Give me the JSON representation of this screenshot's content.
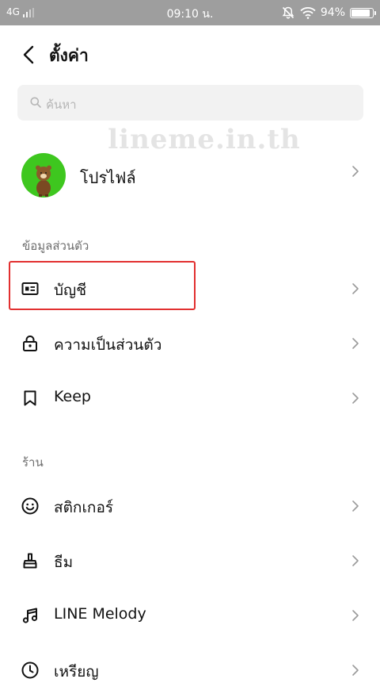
{
  "status_bar": {
    "network": "4G",
    "time": "09:10 น.",
    "battery_percent": "94%",
    "battery_level": 0.94
  },
  "header": {
    "back_icon": "chevron-left-icon",
    "title": "ตั้งค่า"
  },
  "search": {
    "placeholder": "ค้นหา"
  },
  "watermark": "lineme.in.th",
  "profile": {
    "label": "โปรไฟล์"
  },
  "sections": {
    "personal": {
      "label": "ข้อมูลส่วนตัว",
      "items": [
        {
          "label": "บัญชี",
          "icon": "id-card-icon"
        },
        {
          "label": "ความเป็นส่วนตัว",
          "icon": "lock-icon"
        },
        {
          "label": "Keep",
          "icon": "bookmark-icon"
        }
      ]
    },
    "shop": {
      "label": "ร้าน",
      "items": [
        {
          "label": "สติกเกอร์",
          "icon": "smiley-icon"
        },
        {
          "label": "ธีม",
          "icon": "brush-icon"
        },
        {
          "label": "LINE Melody",
          "icon": "music-note-icon"
        },
        {
          "label": "เหรียญ",
          "icon": "clock-icon"
        }
      ]
    }
  },
  "colors": {
    "status_bar_bg": "#9e9e9e",
    "search_bg": "#f2f2f2",
    "highlight_border": "#e23030",
    "avatar_bg": "#3ec71f"
  }
}
